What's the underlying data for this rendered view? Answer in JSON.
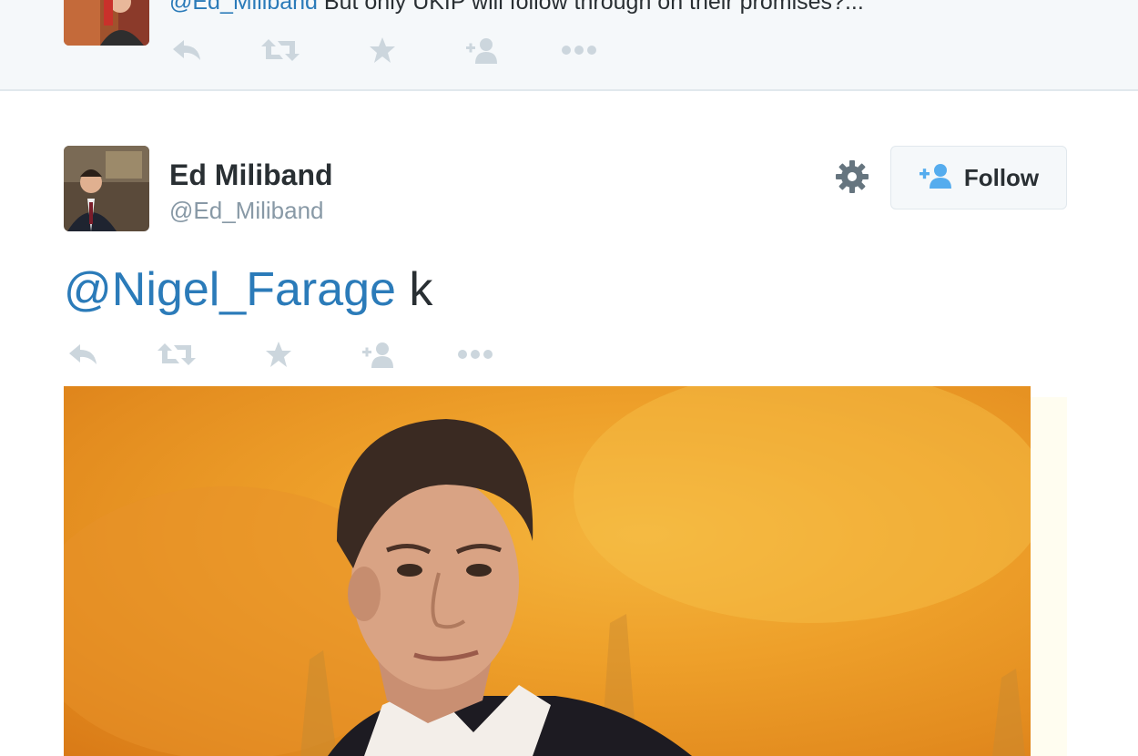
{
  "previous_tweet": {
    "mention": "@Ed_Miliband",
    "text": " But only UKIP will follow through on their promises?...",
    "actions": [
      "reply-icon",
      "retweet-icon",
      "favorite-icon",
      "follow-icon",
      "more-icon"
    ]
  },
  "tweet": {
    "author_name": "Ed Miliband",
    "author_handle": "@Ed_Miliband",
    "follow_label": "Follow",
    "mention": "@Nigel_Farage",
    "text": " k",
    "actions": [
      "reply-icon",
      "retweet-icon",
      "favorite-icon",
      "follow-icon",
      "more-icon"
    ]
  },
  "colors": {
    "link": "#2b7bb9",
    "icon": "#ccd6dd",
    "text": "#292f33",
    "muted": "#8899a6",
    "follow_icon": "#55acee"
  }
}
